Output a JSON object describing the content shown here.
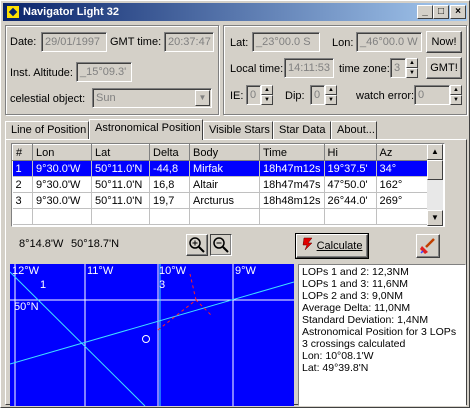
{
  "window": {
    "title": "Navigator Light 32"
  },
  "titlebar_buttons": [
    "_",
    "□",
    "×"
  ],
  "left": {
    "date_label": "Date:",
    "date_value": "29/01/1997",
    "gmt_label": "GMT time:",
    "gmt_value": "20:37:47",
    "altitude_label": "Inst. Altitude:",
    "altitude_value": "_15°09.3'",
    "object_label": "celestial object:",
    "object_value": "Sun"
  },
  "right": {
    "lat_label": "Lat:",
    "lat_value": "_23°00.0 S",
    "lon_label": "Lon:",
    "lon_value": "_46°00.0 W",
    "now_button": "Now!",
    "local_label": "Local time:",
    "local_value": "14:11:53",
    "tz_label": "time zone:",
    "tz_value": "3",
    "gmt_button": "GMT!",
    "ie_label": "IE:",
    "ie_value": "0",
    "dip_label": "Dip:",
    "dip_value": "0",
    "watch_label": "watch error:",
    "watch_value": "0"
  },
  "tabs": [
    "Line of Position",
    "Astronomical Position",
    "Visible Stars",
    "Star Data",
    "About..."
  ],
  "table": {
    "columns": [
      "#",
      "Lon",
      "Lat",
      "Delta",
      "Body",
      "Time",
      "Hi",
      "Az"
    ],
    "rows": [
      [
        "1",
        "9°30.0'W",
        "50°11.0'N",
        "-44,8",
        "Mirfak",
        "18h47m12s",
        "19°37.5'",
        "34°"
      ],
      [
        "2",
        "9°30.0'W",
        "50°11.0'N",
        "16,8",
        "Altair",
        "18h47m47s",
        "47°50.0'",
        "162°"
      ],
      [
        "3",
        "9°30.0'W",
        "50°11.0'N",
        "19,7",
        "Arcturus",
        "18h48m12s",
        "26°44.0'",
        "269°"
      ]
    ]
  },
  "coords": {
    "lon": "8°14.8'W",
    "lat": "50°18.7'N"
  },
  "calculate_button": "Calculate",
  "map": {
    "lon_labels": [
      "12°W",
      "11°W",
      "10°W",
      "9°W"
    ],
    "lat_label": "50°N",
    "point_labels": [
      "1",
      "3"
    ],
    "colors": {
      "background": "#0000ff",
      "grid": "#ffffff",
      "lop": "#40e0ff",
      "path": "#ff2020"
    }
  },
  "results": [
    "LOPs 1 and 2: 12,3NM",
    "LOPs 1 and 3: 11,6NM",
    "LOPs 2 and 3:  9,0NM",
    "Average Delta: 11,0NM",
    "Standard Deviation:   1,4NM",
    "Astronomical Position for 3 LOPs",
    "3 crossings calculated",
    "Lon: 10°08.1'W",
    "Lat: 49°39.8'N"
  ]
}
